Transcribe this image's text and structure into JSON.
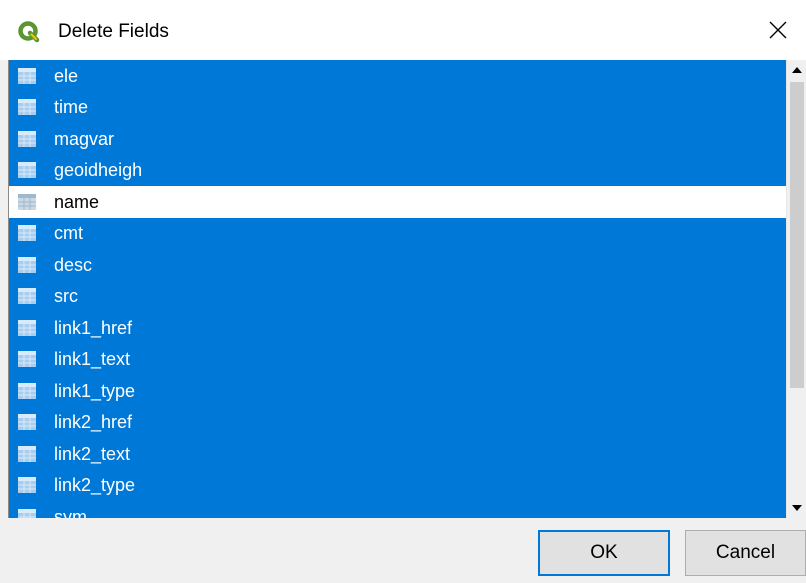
{
  "window": {
    "title": "Delete Fields",
    "app_icon": "qgis-logo-icon",
    "close_icon": "close-icon"
  },
  "fields": [
    {
      "label": "ele",
      "selected": true
    },
    {
      "label": "time",
      "selected": true
    },
    {
      "label": "magvar",
      "selected": true
    },
    {
      "label": "geoidheigh",
      "selected": true
    },
    {
      "label": "name",
      "selected": false
    },
    {
      "label": "cmt",
      "selected": true
    },
    {
      "label": "desc",
      "selected": true
    },
    {
      "label": "src",
      "selected": true
    },
    {
      "label": "link1_href",
      "selected": true
    },
    {
      "label": "link1_text",
      "selected": true
    },
    {
      "label": "link1_type",
      "selected": true
    },
    {
      "label": "link2_href",
      "selected": true
    },
    {
      "label": "link2_text",
      "selected": true
    },
    {
      "label": "link2_type",
      "selected": true
    },
    {
      "label": "sym",
      "selected": true
    }
  ],
  "field_icon": "table-field-icon",
  "buttons": {
    "ok_label": "OK",
    "cancel_label": "Cancel"
  },
  "colors": {
    "selection": "#0078d7",
    "qgis_green": "#589632",
    "qgis_yellow": "#ee7913"
  }
}
